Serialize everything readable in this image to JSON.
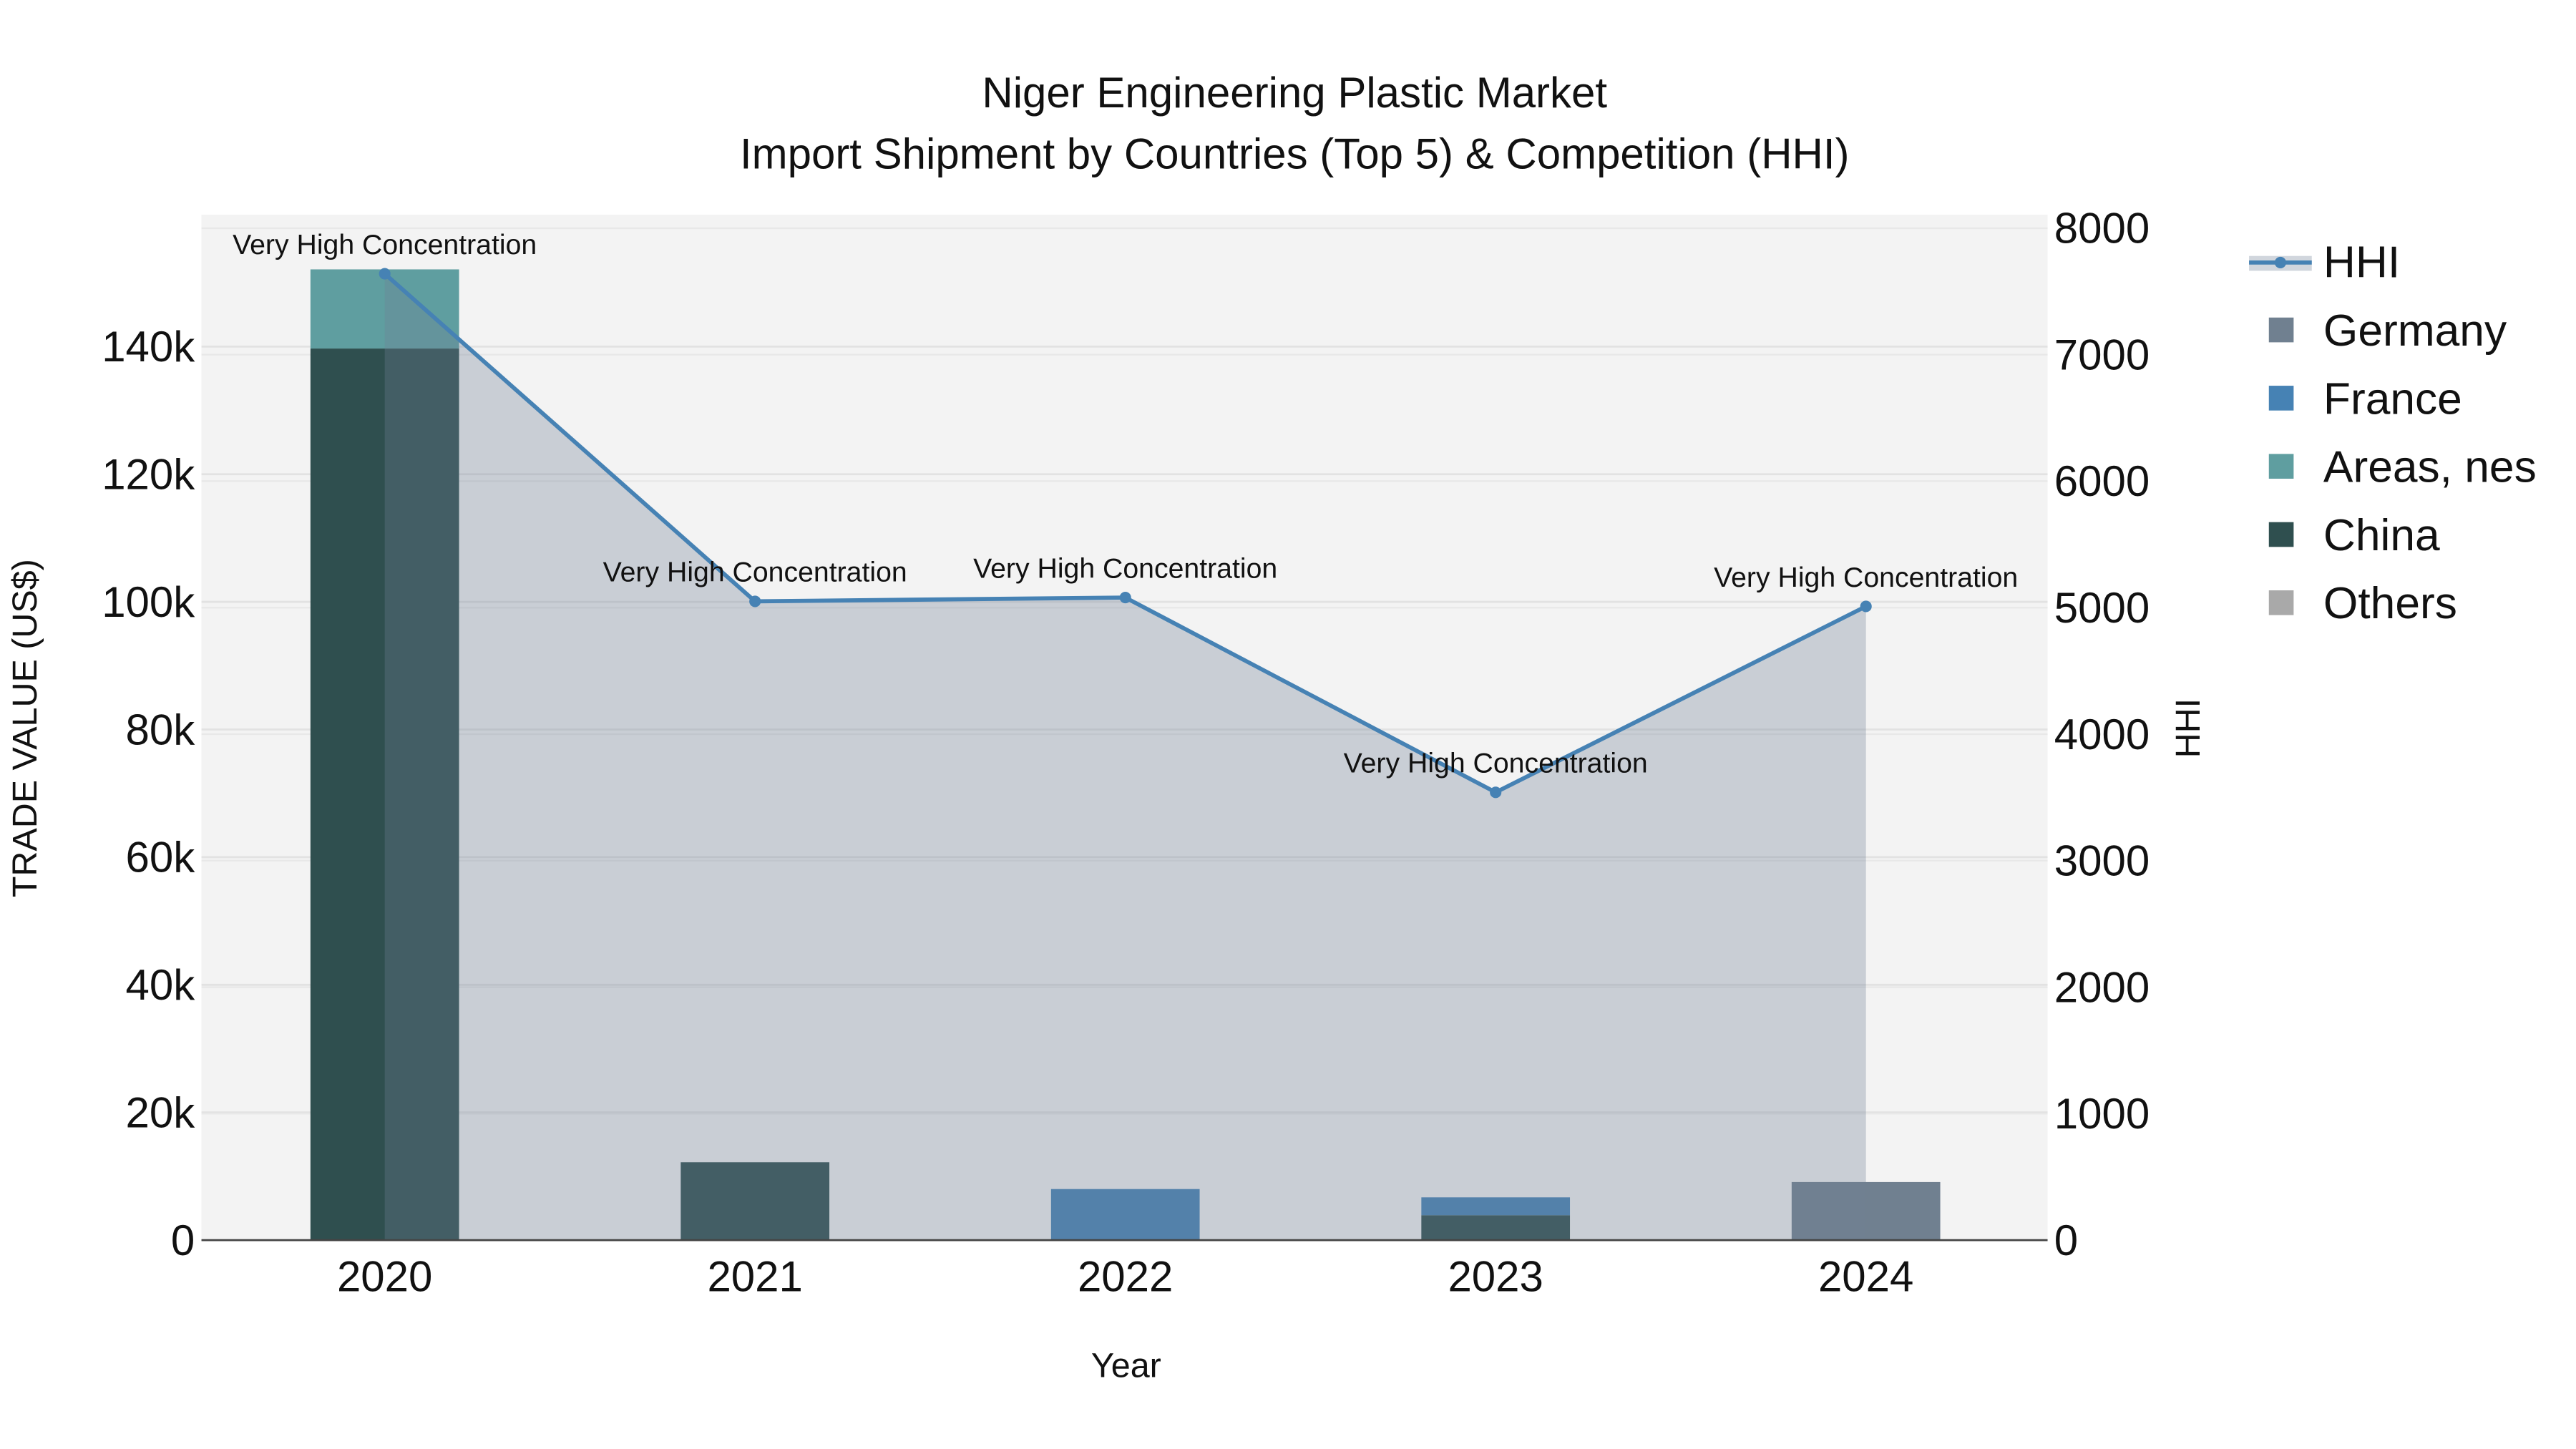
{
  "chart_data": {
    "type": "bar",
    "title": "Niger Engineering Plastic Market",
    "subtitle": "Import Shipment by Countries (Top 5) & Competition (HHI)",
    "xlabel": "Year",
    "ylabel": "TRADE VALUE (US$)",
    "y2label": "HHI",
    "categories": [
      "2020",
      "2021",
      "2022",
      "2023",
      "2024"
    ],
    "ylim": [
      0,
      160000
    ],
    "yticks": [
      0,
      20000,
      40000,
      60000,
      80000,
      100000,
      120000,
      140000
    ],
    "ytick_labels": [
      "0",
      "20k",
      "40k",
      "60k",
      "80k",
      "100k",
      "120k",
      "140k"
    ],
    "y2lim": [
      0,
      8100
    ],
    "y2ticks": [
      0,
      1000,
      2000,
      3000,
      4000,
      5000,
      6000,
      7000,
      8000
    ],
    "y2tick_labels": [
      "0",
      "1000",
      "2000",
      "3000",
      "4000",
      "5000",
      "6000",
      "7000",
      "8000"
    ],
    "barmode": "stack",
    "series": [
      {
        "name": "China",
        "color": "#2F4F4F",
        "values": [
          139700,
          12200,
          0,
          3900,
          0
        ]
      },
      {
        "name": "Areas, nes",
        "color": "#5F9EA0",
        "values": [
          12400,
          0,
          0,
          0,
          0
        ]
      },
      {
        "name": "France",
        "color": "#4682B4",
        "values": [
          0,
          0,
          8000,
          2800,
          0
        ]
      },
      {
        "name": "Germany",
        "color": "#708090",
        "values": [
          0,
          0,
          0,
          0,
          9100
        ]
      },
      {
        "name": "Others",
        "color": "#A9A9A9",
        "values": [
          0,
          0,
          0,
          0,
          0
        ]
      }
    ],
    "hhi": {
      "name": "HHI",
      "color": "#4682B4",
      "values": [
        7640,
        5050,
        5080,
        3540,
        5010
      ],
      "annotations": [
        "Very High Concentration",
        "Very High Concentration",
        "Very High Concentration",
        "Very High Concentration",
        "Very High Concentration"
      ]
    },
    "legend": {
      "position": "right",
      "entries": [
        "HHI",
        "Germany",
        "France",
        "Areas, nes",
        "China",
        "Others"
      ]
    },
    "grid": true
  }
}
